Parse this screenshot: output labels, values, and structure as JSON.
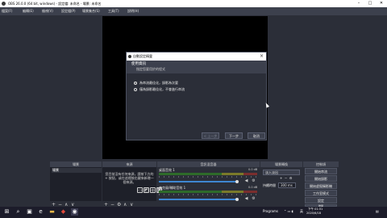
{
  "window": {
    "title": "OBS 26.0.0 (64 bit, windows) - 設定檔: 未命名 - 場景: 未命名"
  },
  "menu": [
    "檔案(F)",
    "編輯(E)",
    "檢視(V)",
    "設定檔(P)",
    "場景集合(S)",
    "工具(T)",
    "說明(H)"
  ],
  "dialog": {
    "title": "自動設定精靈",
    "heading": "使用資訊",
    "subheading": "指定您要用於的程式",
    "options": [
      {
        "label": "為串流最佳化，錄影為次要",
        "selected": true
      },
      {
        "label": "僅為錄影最佳化，不會進行串流",
        "selected": false
      }
    ],
    "back": "< 上一步",
    "next": "下一步",
    "cancel": "取消"
  },
  "docks": {
    "scenes": "場景",
    "sources": "來源",
    "mixer": "音訊混音器",
    "transitions": "場景轉換",
    "controls": "控制項"
  },
  "scenes": {
    "items": [
      "場景"
    ]
  },
  "sources": {
    "empty_text": "您目前沒有任何來源，請按下方的 + 按鈕，或在這裡按右鍵來新增一個來源。"
  },
  "mixer": {
    "channels": [
      {
        "name": "桌面音效 1",
        "db": "0.0 dB"
      },
      {
        "name": "麥克風/輔助音效 1",
        "db": "0.0 dB"
      }
    ]
  },
  "transitions": {
    "selected": "淡入淡出",
    "duration_label": "持續時間",
    "duration_value": "300 ms"
  },
  "controls": {
    "buttons": [
      "開始串流",
      "開始錄影",
      "開始虛擬攝影機",
      "工作室模式",
      "設定",
      "離開"
    ]
  },
  "taskbar": {
    "lang": "Programs",
    "ime": "英",
    "time": "下午 01:31",
    "date": "2020/6/18"
  },
  "colors": {
    "accent": "#3e86d1",
    "panel": "#2b2e38",
    "dock_header": "#3c404d"
  }
}
